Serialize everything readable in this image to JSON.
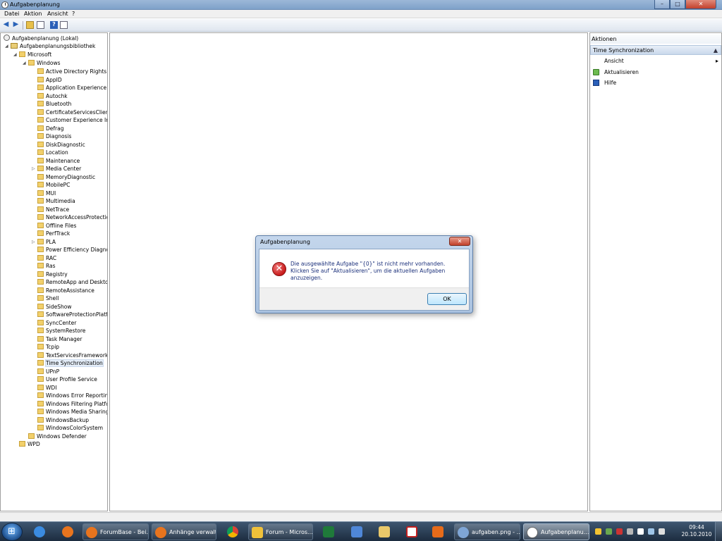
{
  "window": {
    "title": "Aufgabenplanung",
    "controls": {
      "minimize": "–",
      "maximize": "□",
      "close": "✕"
    }
  },
  "menu": {
    "items": [
      "Datei",
      "Aktion",
      "Ansicht",
      "?"
    ]
  },
  "toolbar": {
    "icons": [
      "back-arrow-icon",
      "forward-arrow-icon",
      "folder-up-icon",
      "properties-icon",
      "help-icon",
      "show-pane-icon"
    ]
  },
  "tree": {
    "root": "Aufgabenplanung (Lokal)",
    "library": "Aufgabenplanungsbibliothek",
    "microsoft": "Microsoft",
    "windows": "Windows",
    "windows_children": [
      "Active Directory Rights M",
      "AppID",
      "Application Experience",
      "Autochk",
      "Bluetooth",
      "CertificateServicesClient",
      "Customer Experience Imp",
      "Defrag",
      "Diagnosis",
      "DiskDiagnostic",
      "Location",
      "Maintenance",
      "Media Center",
      "MemoryDiagnostic",
      "MobilePC",
      "MUI",
      "Multimedia",
      "NetTrace",
      "NetworkAccessProtection",
      "Offline Files",
      "PerfTrack",
      "PLA",
      "Power Efficiency Diagnos",
      "RAC",
      "Ras",
      "Registry",
      "RemoteApp and Desktop",
      "RemoteAssistance",
      "Shell",
      "SideShow",
      "SoftwareProtectionPlatfo",
      "SyncCenter",
      "SystemRestore",
      "Task Manager",
      "Tcpip",
      "TextServicesFramework",
      "Time Synchronization",
      "UPnP",
      "User Profile Service",
      "WDI",
      "Windows Error Reporting",
      "Windows Filtering Platfor",
      "Windows Media Sharing",
      "WindowsBackup",
      "WindowsColorSystem"
    ],
    "windows_defender": "Windows Defender",
    "wpd": "WPD",
    "selected": "Time Synchronization",
    "scroll": {
      "left": "◂",
      "right": "▸"
    }
  },
  "actions": {
    "header": "Aktionen",
    "section": "Time Synchronization",
    "section_caret": "▲",
    "items": [
      {
        "label": "Ansicht",
        "arrow": "▸"
      },
      {
        "label": "Aktualisieren"
      },
      {
        "label": "Hilfe"
      }
    ]
  },
  "dialog": {
    "title": "Aufgabenplanung",
    "close": "✕",
    "icon_glyph": "✕",
    "message": "Die ausgewählte Aufgabe \"{0}\" ist nicht mehr vorhanden. Klicken Sie auf \"Aktualisieren\", um die aktuellen Aufgaben anzuzeigen.",
    "ok": "OK"
  },
  "taskbar": {
    "buttons": [
      {
        "label": "ForumBase - Bei..."
      },
      {
        "label": "Anhänge verwalt..."
      },
      {
        "label": "Forum - Micros..."
      },
      {
        "label": "aufgaben.png - ..."
      },
      {
        "label": "Aufgabenplanu..."
      }
    ],
    "clock": {
      "time": "09:44",
      "date": "20.10.2010"
    }
  },
  "colors": {
    "titlebar": "#9cb8d8",
    "close_button": "#c2412c",
    "taskbar": "#1c2c3f",
    "selection": "#e5eef9",
    "error": "#c81b1b"
  }
}
